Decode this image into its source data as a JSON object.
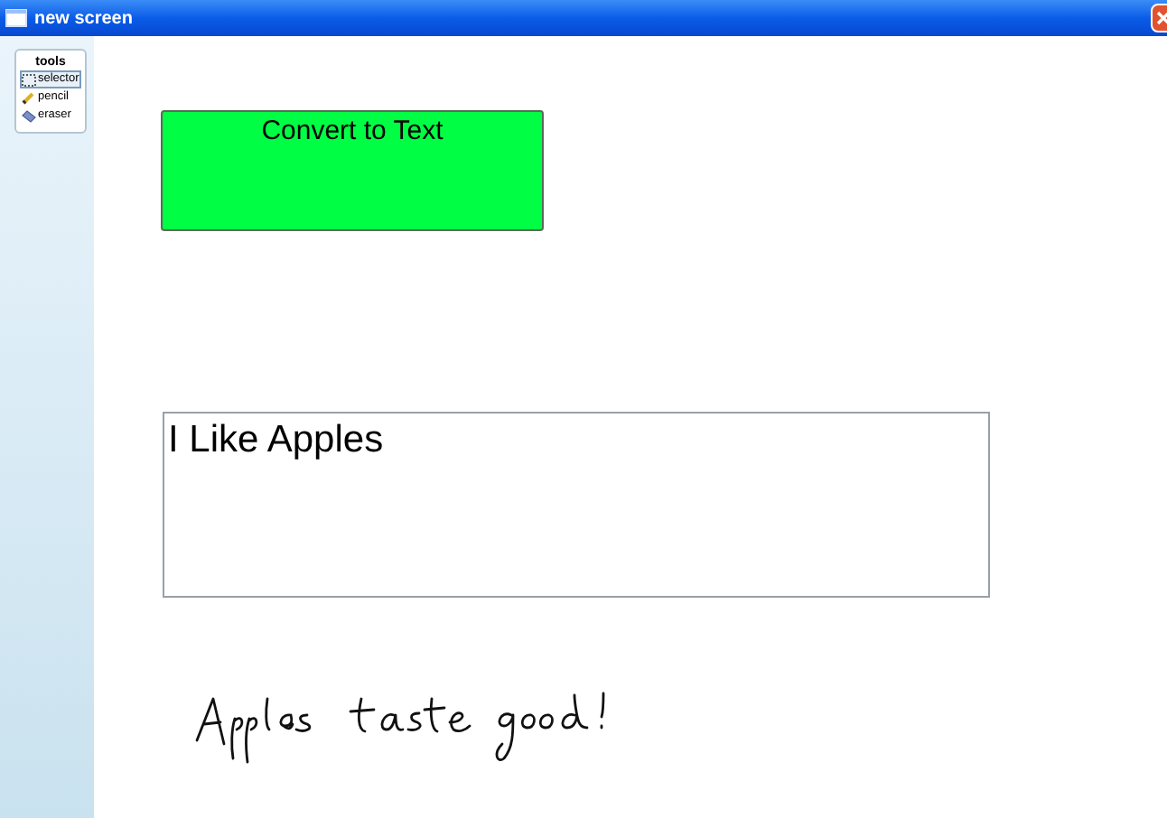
{
  "window": {
    "title": "new screen"
  },
  "tools": {
    "title": "tools",
    "items": [
      {
        "label": "selector",
        "kind": "selector",
        "selected": true
      },
      {
        "label": "pencil",
        "kind": "pencil",
        "selected": false
      },
      {
        "label": "eraser",
        "kind": "eraser",
        "selected": false
      }
    ]
  },
  "convert_button": {
    "label": "Convert to Text"
  },
  "text_box": {
    "value": "I Like Apples"
  }
}
